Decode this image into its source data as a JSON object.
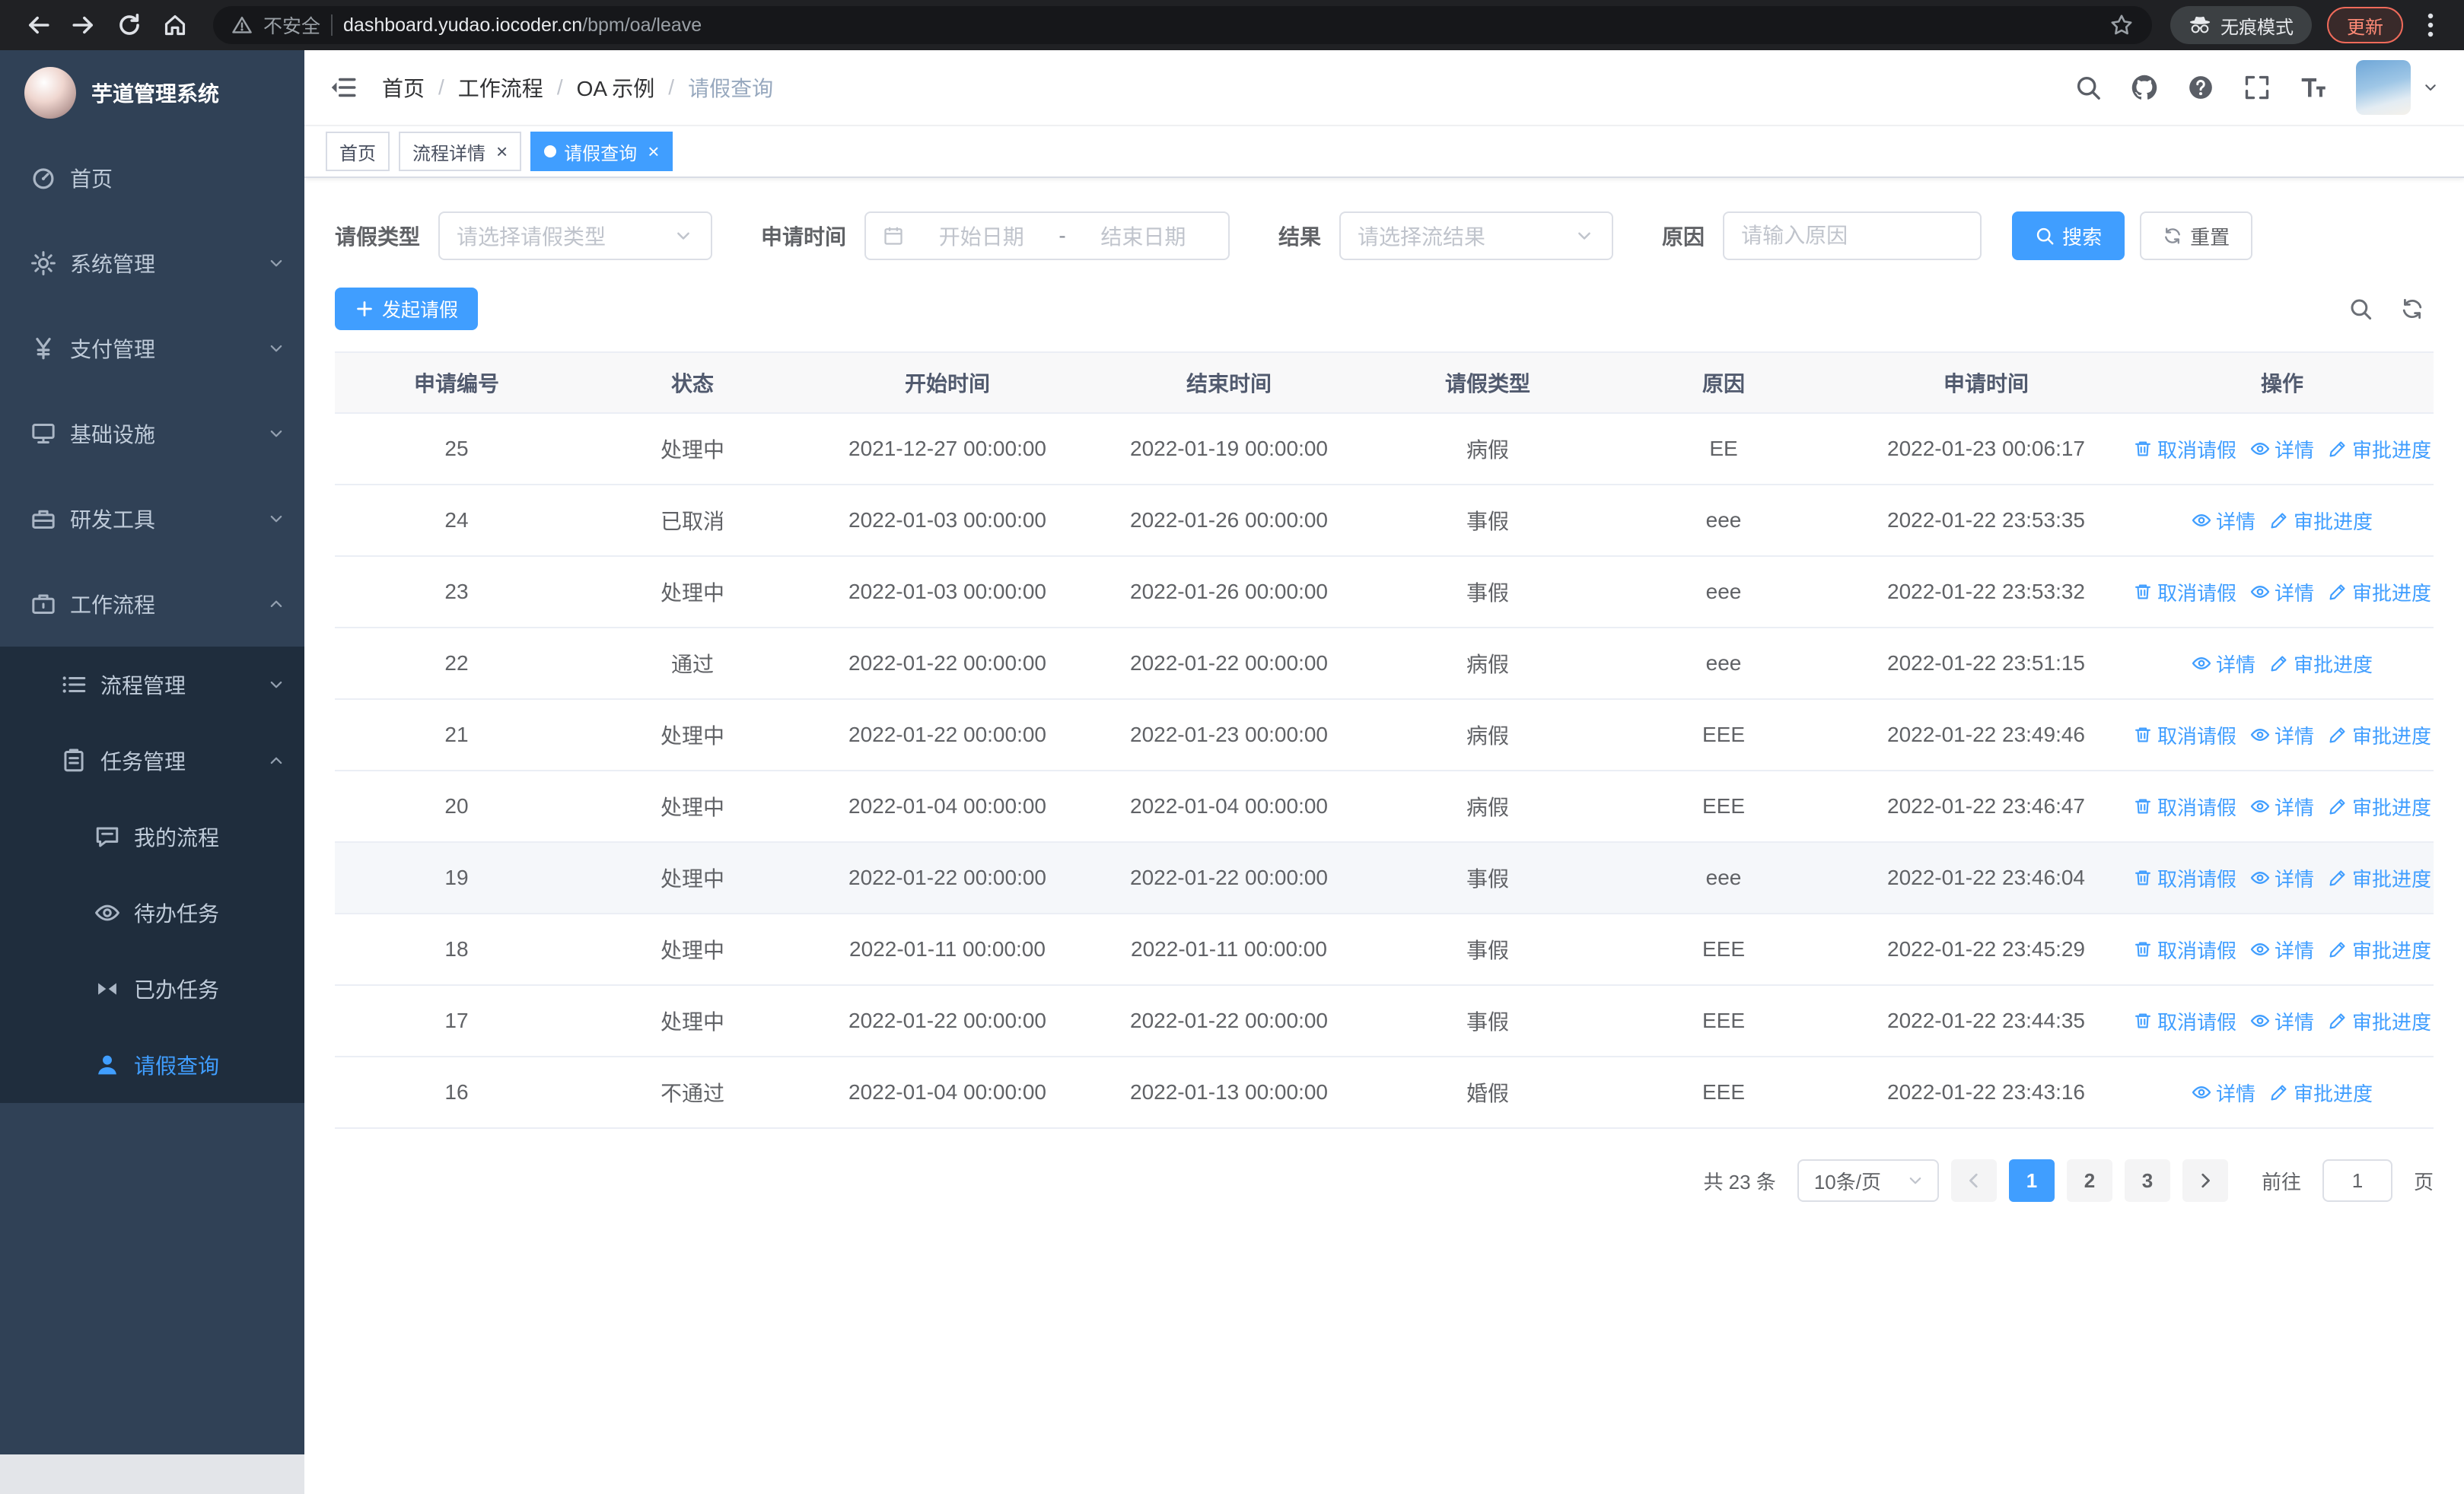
{
  "browser": {
    "security_warning": "不安全",
    "url_domain": "dashboard.yudao.iocoder.cn",
    "url_path": "/bpm/oa/leave",
    "incognito_label": "无痕模式",
    "update_label": "更新"
  },
  "sidebar": {
    "logo_title": "芋道管理系统",
    "menu": [
      {
        "key": "home",
        "label": "首页",
        "icon": "dash"
      },
      {
        "key": "system",
        "label": "系统管理",
        "icon": "gear",
        "chevron": "down"
      },
      {
        "key": "payment",
        "label": "支付管理",
        "icon": "yen",
        "chevron": "down"
      },
      {
        "key": "infrastructure",
        "label": "基础设施",
        "icon": "infra",
        "chevron": "down"
      },
      {
        "key": "devtools",
        "label": "研发工具",
        "icon": "tools",
        "chevron": "down"
      },
      {
        "key": "workflow",
        "label": "工作流程",
        "icon": "work",
        "chevron": "up",
        "children": [
          {
            "key": "process-management",
            "label": "流程管理",
            "icon": "list",
            "chevron": "down"
          },
          {
            "key": "task-management",
            "label": "任务管理",
            "icon": "clip",
            "chevron": "up",
            "children": [
              {
                "key": "my-process",
                "label": "我的流程",
                "icon": "chat"
              },
              {
                "key": "todo-tasks",
                "label": "待办任务",
                "icon": "eye"
              },
              {
                "key": "done-tasks",
                "label": "已办任务",
                "icon": "bowtie"
              },
              {
                "key": "leave-query",
                "label": "请假查询",
                "icon": "user",
                "active": true
              }
            ]
          }
        ]
      }
    ]
  },
  "header": {
    "breadcrumb": [
      "首页",
      "工作流程",
      "OA 示例",
      "请假查询"
    ],
    "breadcrumb_separator": "/"
  },
  "tabs": [
    {
      "key": "home",
      "label": "首页",
      "closable": false,
      "active": false
    },
    {
      "key": "process-detail",
      "label": "流程详情",
      "closable": true,
      "active": false
    },
    {
      "key": "leave-query",
      "label": "请假查询",
      "closable": true,
      "active": true
    }
  ],
  "filters": {
    "leave_type_label": "请假类型",
    "leave_type_placeholder": "请选择请假类型",
    "apply_time_label": "申请时间",
    "start_date_placeholder": "开始日期",
    "range_separator": "-",
    "end_date_placeholder": "结束日期",
    "result_label": "结果",
    "result_placeholder": "请选择流结果",
    "reason_label": "原因",
    "reason_placeholder": "请输入原因",
    "search_button": "搜索",
    "reset_button": "重置"
  },
  "toolbar": {
    "create_button": "发起请假"
  },
  "table": {
    "columns": [
      "申请编号",
      "状态",
      "开始时间",
      "结束时间",
      "请假类型",
      "原因",
      "申请时间",
      "操作"
    ],
    "actions": {
      "cancel": "取消请假",
      "detail": "详情",
      "progress": "审批进度"
    },
    "rows": [
      {
        "id": "25",
        "status": "处理中",
        "start": "2021-12-27 00:00:00",
        "end": "2022-01-19 00:00:00",
        "type": "病假",
        "reason": "EE",
        "applied": "2022-01-23 00:06:17",
        "cancellable": true
      },
      {
        "id": "24",
        "status": "已取消",
        "start": "2022-01-03 00:00:00",
        "end": "2022-01-26 00:00:00",
        "type": "事假",
        "reason": "eee",
        "applied": "2022-01-22 23:53:35",
        "cancellable": false
      },
      {
        "id": "23",
        "status": "处理中",
        "start": "2022-01-03 00:00:00",
        "end": "2022-01-26 00:00:00",
        "type": "事假",
        "reason": "eee",
        "applied": "2022-01-22 23:53:32",
        "cancellable": true
      },
      {
        "id": "22",
        "status": "通过",
        "start": "2022-01-22 00:00:00",
        "end": "2022-01-22 00:00:00",
        "type": "病假",
        "reason": "eee",
        "applied": "2022-01-22 23:51:15",
        "cancellable": false
      },
      {
        "id": "21",
        "status": "处理中",
        "start": "2022-01-22 00:00:00",
        "end": "2022-01-23 00:00:00",
        "type": "病假",
        "reason": "EEE",
        "applied": "2022-01-22 23:49:46",
        "cancellable": true
      },
      {
        "id": "20",
        "status": "处理中",
        "start": "2022-01-04 00:00:00",
        "end": "2022-01-04 00:00:00",
        "type": "病假",
        "reason": "EEE",
        "applied": "2022-01-22 23:46:47",
        "cancellable": true
      },
      {
        "id": "19",
        "status": "处理中",
        "start": "2022-01-22 00:00:00",
        "end": "2022-01-22 00:00:00",
        "type": "事假",
        "reason": "eee",
        "applied": "2022-01-22 23:46:04",
        "cancellable": true,
        "highlight": true
      },
      {
        "id": "18",
        "status": "处理中",
        "start": "2022-01-11 00:00:00",
        "end": "2022-01-11 00:00:00",
        "type": "事假",
        "reason": "EEE",
        "applied": "2022-01-22 23:45:29",
        "cancellable": true
      },
      {
        "id": "17",
        "status": "处理中",
        "start": "2022-01-22 00:00:00",
        "end": "2022-01-22 00:00:00",
        "type": "事假",
        "reason": "EEE",
        "applied": "2022-01-22 23:44:35",
        "cancellable": true
      },
      {
        "id": "16",
        "status": "不通过",
        "start": "2022-01-04 00:00:00",
        "end": "2022-01-13 00:00:00",
        "type": "婚假",
        "reason": "EEE",
        "applied": "2022-01-22 23:43:16",
        "cancellable": false
      }
    ]
  },
  "pagination": {
    "total": "共 23 条",
    "page_size": "10条/页",
    "pages": [
      "1",
      "2",
      "3"
    ],
    "active_page": "1",
    "goto_label": "前往",
    "goto_value": "1",
    "page_label": "页"
  },
  "colors": {
    "primary": "#409eff",
    "sidebar_bg": "#304156",
    "submenu_bg": "#1f2d3d",
    "link": "#409eff",
    "active_tab_bg": "#409eff"
  },
  "icons": {
    "back-icon": "←",
    "forward-icon": "→",
    "reload-icon": "⟳",
    "browser-home-icon": "⌂",
    "security-warning-icon": "⚠",
    "bookmark-star-icon": "☆",
    "incognito-icon": "🕶",
    "kebab-menu-icon": "⋮",
    "sidebar-fold-icon": "☰",
    "search-icon": "🔍",
    "github-icon": "octocat",
    "help-icon": "?",
    "fullscreen-icon": "⛶",
    "font-size-icon": "T",
    "caret-down-icon": "▾",
    "dashboard-icon": "◔",
    "gear-icon": "⚙",
    "yen-icon": "¥",
    "monitor-icon": "🖥",
    "toolbox-icon": "🧰",
    "briefcase-icon": "💼",
    "list-icon": "≡",
    "clipboard-icon": "📋",
    "chat-icon": "💬",
    "eye-icon": "👁",
    "bowtie-icon": "⧓",
    "user-icon": "👤",
    "plus-icon": "+",
    "refresh-icon": "⟲",
    "calendar-icon": "📅",
    "delete-icon": "🗑",
    "view-icon": "👁",
    "edit-icon": "✎",
    "chevron-left-icon": "‹",
    "chevron-right-icon": "›",
    "chevron-down-icon": "⌄",
    "chevron-up-icon": "⌃",
    "tab-close-icon": "×",
    "active-tab-dot-icon": "●"
  }
}
